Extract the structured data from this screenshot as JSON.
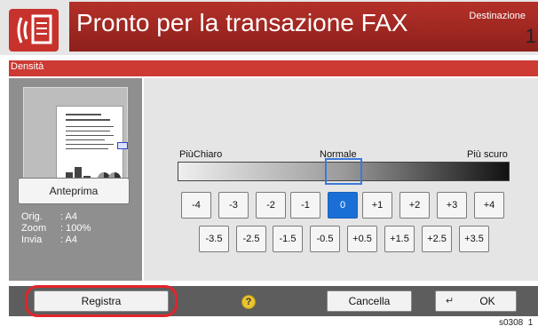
{
  "header": {
    "title": "Pronto per la transazione FAX",
    "destination_label": "Destinazione",
    "destination_count": "1",
    "fax_icon": "fax-document-icon"
  },
  "panel": {
    "title": "Densità"
  },
  "preview": {
    "orig_label": "Orig.",
    "orig_value": ": A4",
    "zoom_label": "Zoom",
    "zoom_value": ": 100%",
    "send_label": "Invia",
    "send_value": ": A4",
    "button_label": "Anteprima"
  },
  "density": {
    "light_label": "PiùChiaro",
    "normal_label": "Normale",
    "dark_label": "Più scuro",
    "selected": "0",
    "row1": [
      "-4",
      "-3",
      "-2",
      "-1",
      "0",
      "+1",
      "+2",
      "+3",
      "+4"
    ],
    "row2": [
      "-3.5",
      "-2.5",
      "-1.5",
      "-0.5",
      "+0.5",
      "+1.5",
      "+2.5",
      "+3.5"
    ]
  },
  "footer": {
    "register_label": "Registra",
    "help_icon": "help-icon",
    "cancel_label": "Cancella",
    "ok_label": "OK"
  },
  "code": "s0308_1",
  "colors": {
    "accent_red": "#c8322c",
    "selected_blue": "#1a6fd6",
    "highlight_ring": "#e2242b"
  }
}
